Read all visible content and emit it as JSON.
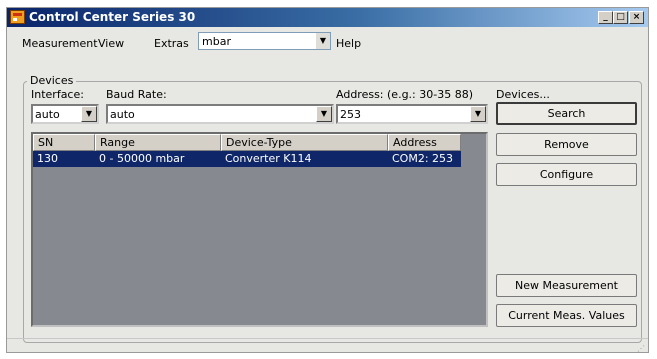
{
  "window": {
    "title": "Control Center Series 30",
    "buttons": {
      "minimize": "_",
      "maximize": "□",
      "close": "×"
    }
  },
  "menubar": {
    "items": [
      "Measurement",
      "View",
      "Extras",
      "Help"
    ],
    "unit_select": {
      "value": "mbar"
    }
  },
  "devices_group": {
    "legend": "Devices",
    "interface": {
      "label": "Interface:",
      "value": "auto"
    },
    "baud_rate": {
      "label": "Baud Rate:",
      "value": "auto"
    },
    "address": {
      "label": "Address: (e.g.: 30-35 88)",
      "value": "253"
    },
    "devices_label": "Devices..."
  },
  "table": {
    "columns": [
      "SN",
      "Range",
      "Device-Type",
      "Address"
    ],
    "rows": [
      {
        "sn": "130",
        "range": "0 - 50000 mbar",
        "device_type": "Converter K114",
        "address": "COM2: 253",
        "selected": true
      }
    ]
  },
  "buttons": {
    "search": "Search",
    "remove": "Remove",
    "configure": "Configure",
    "new_measurement": "New Measurement",
    "current_values": "Current Meas. Values"
  },
  "colors": {
    "titlebar_start": "#0a246a",
    "titlebar_end": "#a6caf0",
    "selection": "#0f2768",
    "list_background": "#86898f",
    "window_background": "#e7e7e3"
  }
}
